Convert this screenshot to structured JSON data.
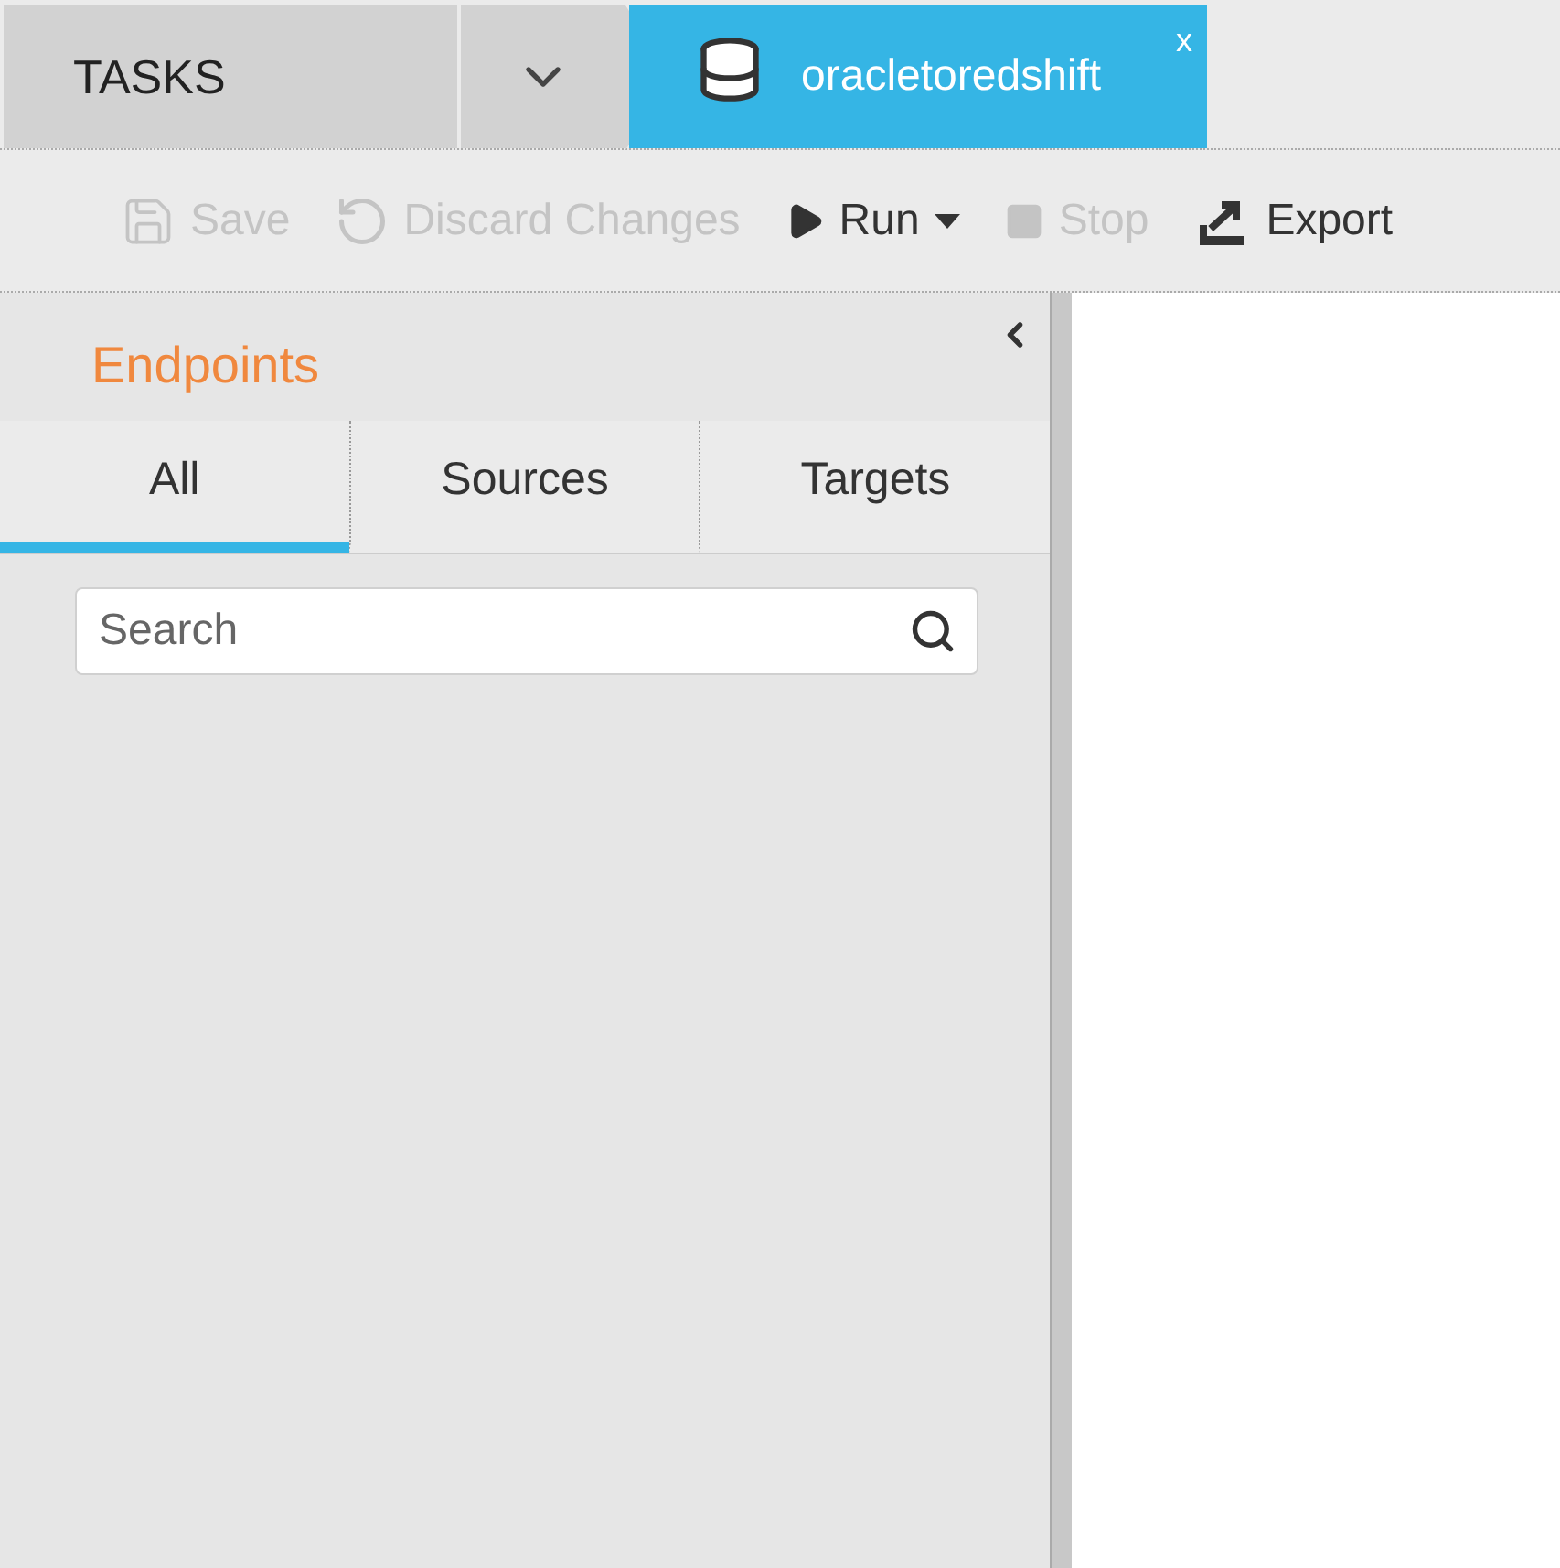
{
  "breadcrumb": {
    "title": "TASKS"
  },
  "open_tab": {
    "label": "oracletoredshift",
    "close": "x"
  },
  "toolbar": [
    {
      "kind": "save",
      "label": "Save",
      "disabled": true
    },
    {
      "kind": "discard",
      "label": "Discard Changes",
      "disabled": true
    },
    {
      "kind": "run",
      "label": "Run",
      "disabled": false
    },
    {
      "kind": "stop",
      "label": "Stop",
      "disabled": true
    },
    {
      "kind": "export",
      "label": "Export",
      "disabled": false
    }
  ],
  "panel": {
    "title": "Endpoints",
    "tabs": [
      {
        "label": "All",
        "selected": true
      },
      {
        "label": "Sources",
        "selected": false
      },
      {
        "label": "Targets",
        "selected": false
      }
    ],
    "search": {
      "placeholder": "Search"
    }
  }
}
